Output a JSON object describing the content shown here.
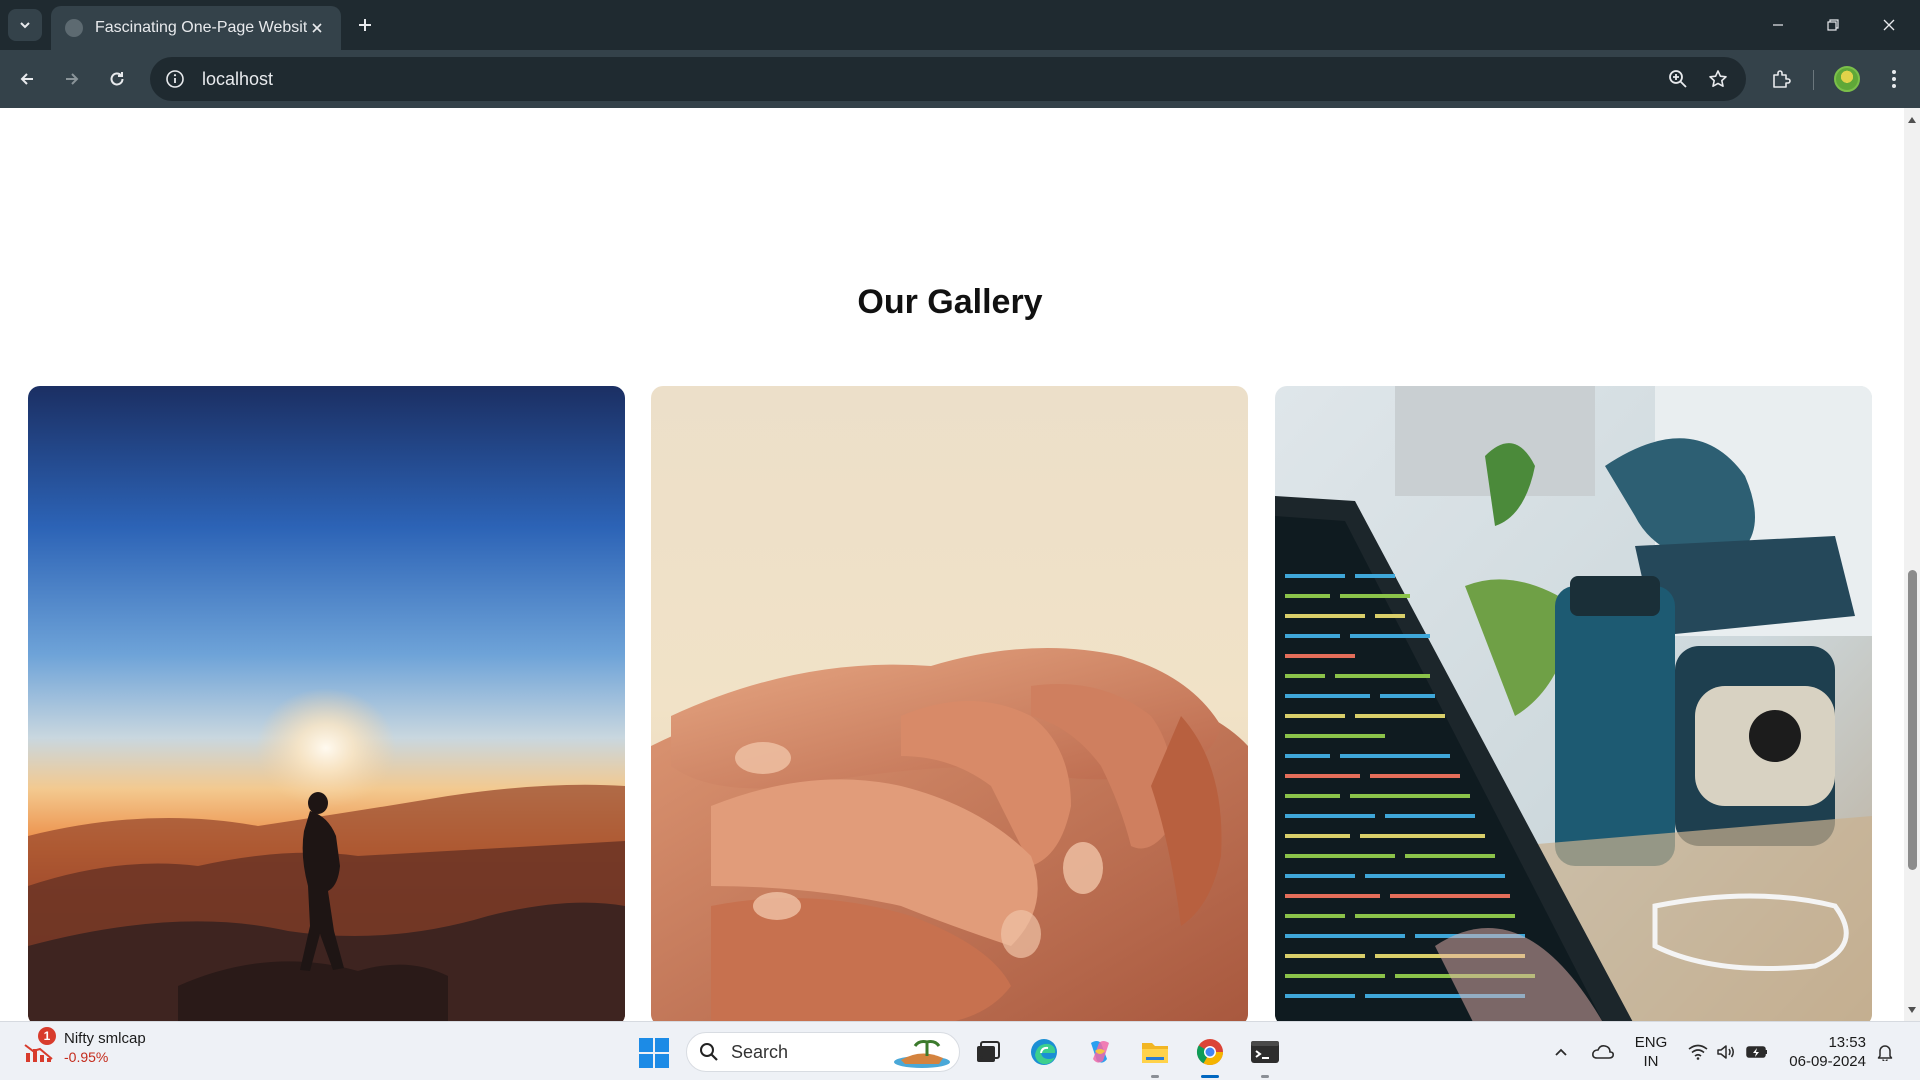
{
  "browser": {
    "tab_title": "Fascinating One-Page Website",
    "url": "localhost"
  },
  "page": {
    "gallery_heading": "Our Gallery",
    "gallery_images": [
      {
        "name": "person-silhouette-sunset-photo"
      },
      {
        "name": "holding-hands-photo"
      },
      {
        "name": "laptop-code-desk-photo"
      }
    ]
  },
  "taskbar": {
    "widget_name": "Nifty smlcap",
    "widget_value": "-0.95%",
    "widget_badge": "1",
    "search_label": "Search",
    "lang_line1": "ENG",
    "lang_line2": "IN",
    "time": "13:53",
    "date": "06-09-2024"
  }
}
